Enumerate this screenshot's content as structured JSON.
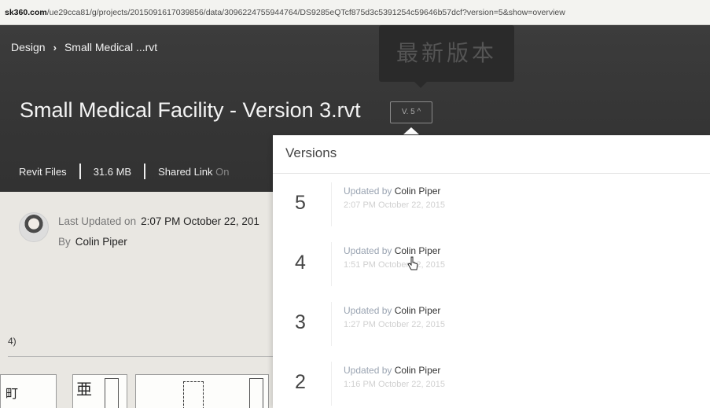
{
  "browser": {
    "url_host": "sk360.com",
    "url_path": "/ue29cca81/g/projects/2015091617039856/data/3096224755944764/DS9285eQTcf875d3c5391254c59646b57dcf?version=5&show=overview"
  },
  "breadcrumb": {
    "parent": "Design",
    "separator": "›",
    "current": "Small Medical ...rvt"
  },
  "tooltip": {
    "text": "最新版本"
  },
  "document": {
    "title": "Small Medical Facility - Version 3.rvt",
    "version_button": "V. 5 ^"
  },
  "meta": {
    "type": "Revit Files",
    "size": "31.6 MB",
    "shared_label": "Shared Link",
    "shared_value": "On"
  },
  "info": {
    "last_updated_label": "Last Updated on",
    "last_updated_value": "2:07 PM October 22, 201",
    "by_label": "By",
    "by_value": "Colin Piper"
  },
  "side": {
    "label": "4)"
  },
  "versions_panel": {
    "title": "Versions",
    "items": [
      {
        "number": "5",
        "updated_by_label": "Updated by",
        "author": "Colin Piper",
        "date": "2:07 PM October 22, 2015"
      },
      {
        "number": "4",
        "updated_by_label": "Updated by",
        "author": "Colin Piper",
        "date": "1:51 PM October 22, 2015"
      },
      {
        "number": "3",
        "updated_by_label": "Updated by",
        "author": "Colin Piper",
        "date": "1:27 PM October 22, 2015"
      },
      {
        "number": "2",
        "updated_by_label": "Updated by",
        "author": "Colin Piper",
        "date": "1:16 PM October 22, 2015"
      }
    ]
  },
  "thumbnails": {
    "label_a": "町",
    "label_b": "亜"
  }
}
